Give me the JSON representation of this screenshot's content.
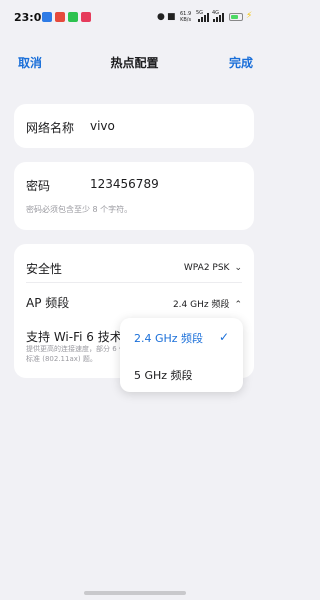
{
  "status": {
    "time": "23:07",
    "net_speed_top": "61.9",
    "net_speed_bottom": "KB/s",
    "sig1_label": "5G",
    "sig2_label": "4G"
  },
  "nav": {
    "cancel": "取消",
    "title": "热点配置",
    "done": "完成"
  },
  "network_name": {
    "label": "网络名称",
    "value": "vivo"
  },
  "password": {
    "label": "密码",
    "value": "123456789",
    "hint": "密码必须包含至少 8 个字符。"
  },
  "security": {
    "label": "安全性",
    "value": "WPA2 PSK"
  },
  "ap_band": {
    "label": "AP 频段",
    "value": "2.4 GHz 频段"
  },
  "wifi6": {
    "label": "支持 Wi-Fi 6 技术标",
    "desc": "提供更高的连接速度，部分 6 代技术标准 (802.11ax) 题。"
  },
  "dropdown": {
    "options": [
      {
        "label": "2.4 GHz 频段",
        "selected": true
      },
      {
        "label": "5 GHz 频段",
        "selected": false
      }
    ]
  },
  "colors": {
    "accent": "#1a6fd9",
    "background": "#f1f1f5",
    "card": "#ffffff"
  }
}
